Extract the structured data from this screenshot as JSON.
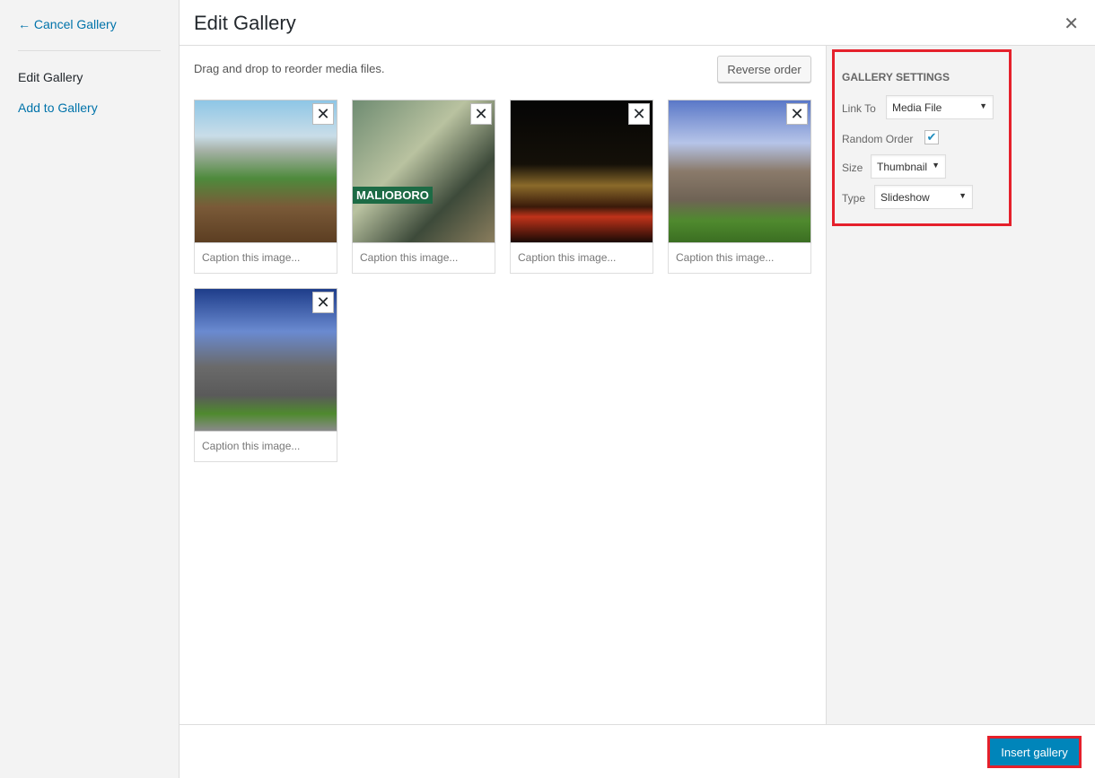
{
  "sidebar": {
    "cancel": "← Cancel Gallery",
    "current": "Edit Gallery",
    "add": "Add to Gallery"
  },
  "header": {
    "title": "Edit Gallery",
    "close": "✕"
  },
  "content": {
    "hint": "Drag and drop to reorder media files.",
    "reverse": "Reverse order",
    "images": [
      {
        "caption_placeholder": "Caption this image..."
      },
      {
        "caption_placeholder": "Caption this image..."
      },
      {
        "caption_placeholder": "Caption this image..."
      },
      {
        "caption_placeholder": "Caption this image..."
      },
      {
        "caption_placeholder": "Caption this image..."
      }
    ],
    "remove": "✕",
    "overlay_text": "MALIOBORO"
  },
  "settings": {
    "title": "Gallery Settings",
    "link_to_label": "Link To",
    "link_to": "Media File",
    "random_label": "Random Order",
    "random_checked": true,
    "check": "✔",
    "size_label": "Size",
    "size": "Thumbnail",
    "type_label": "Type",
    "type": "Slideshow",
    "arrow": "▼"
  },
  "footer": {
    "insert": "Insert gallery"
  },
  "colors": {
    "accent": "#0073aa",
    "primary_button": "#0085ba",
    "highlight": "#e5202b"
  }
}
